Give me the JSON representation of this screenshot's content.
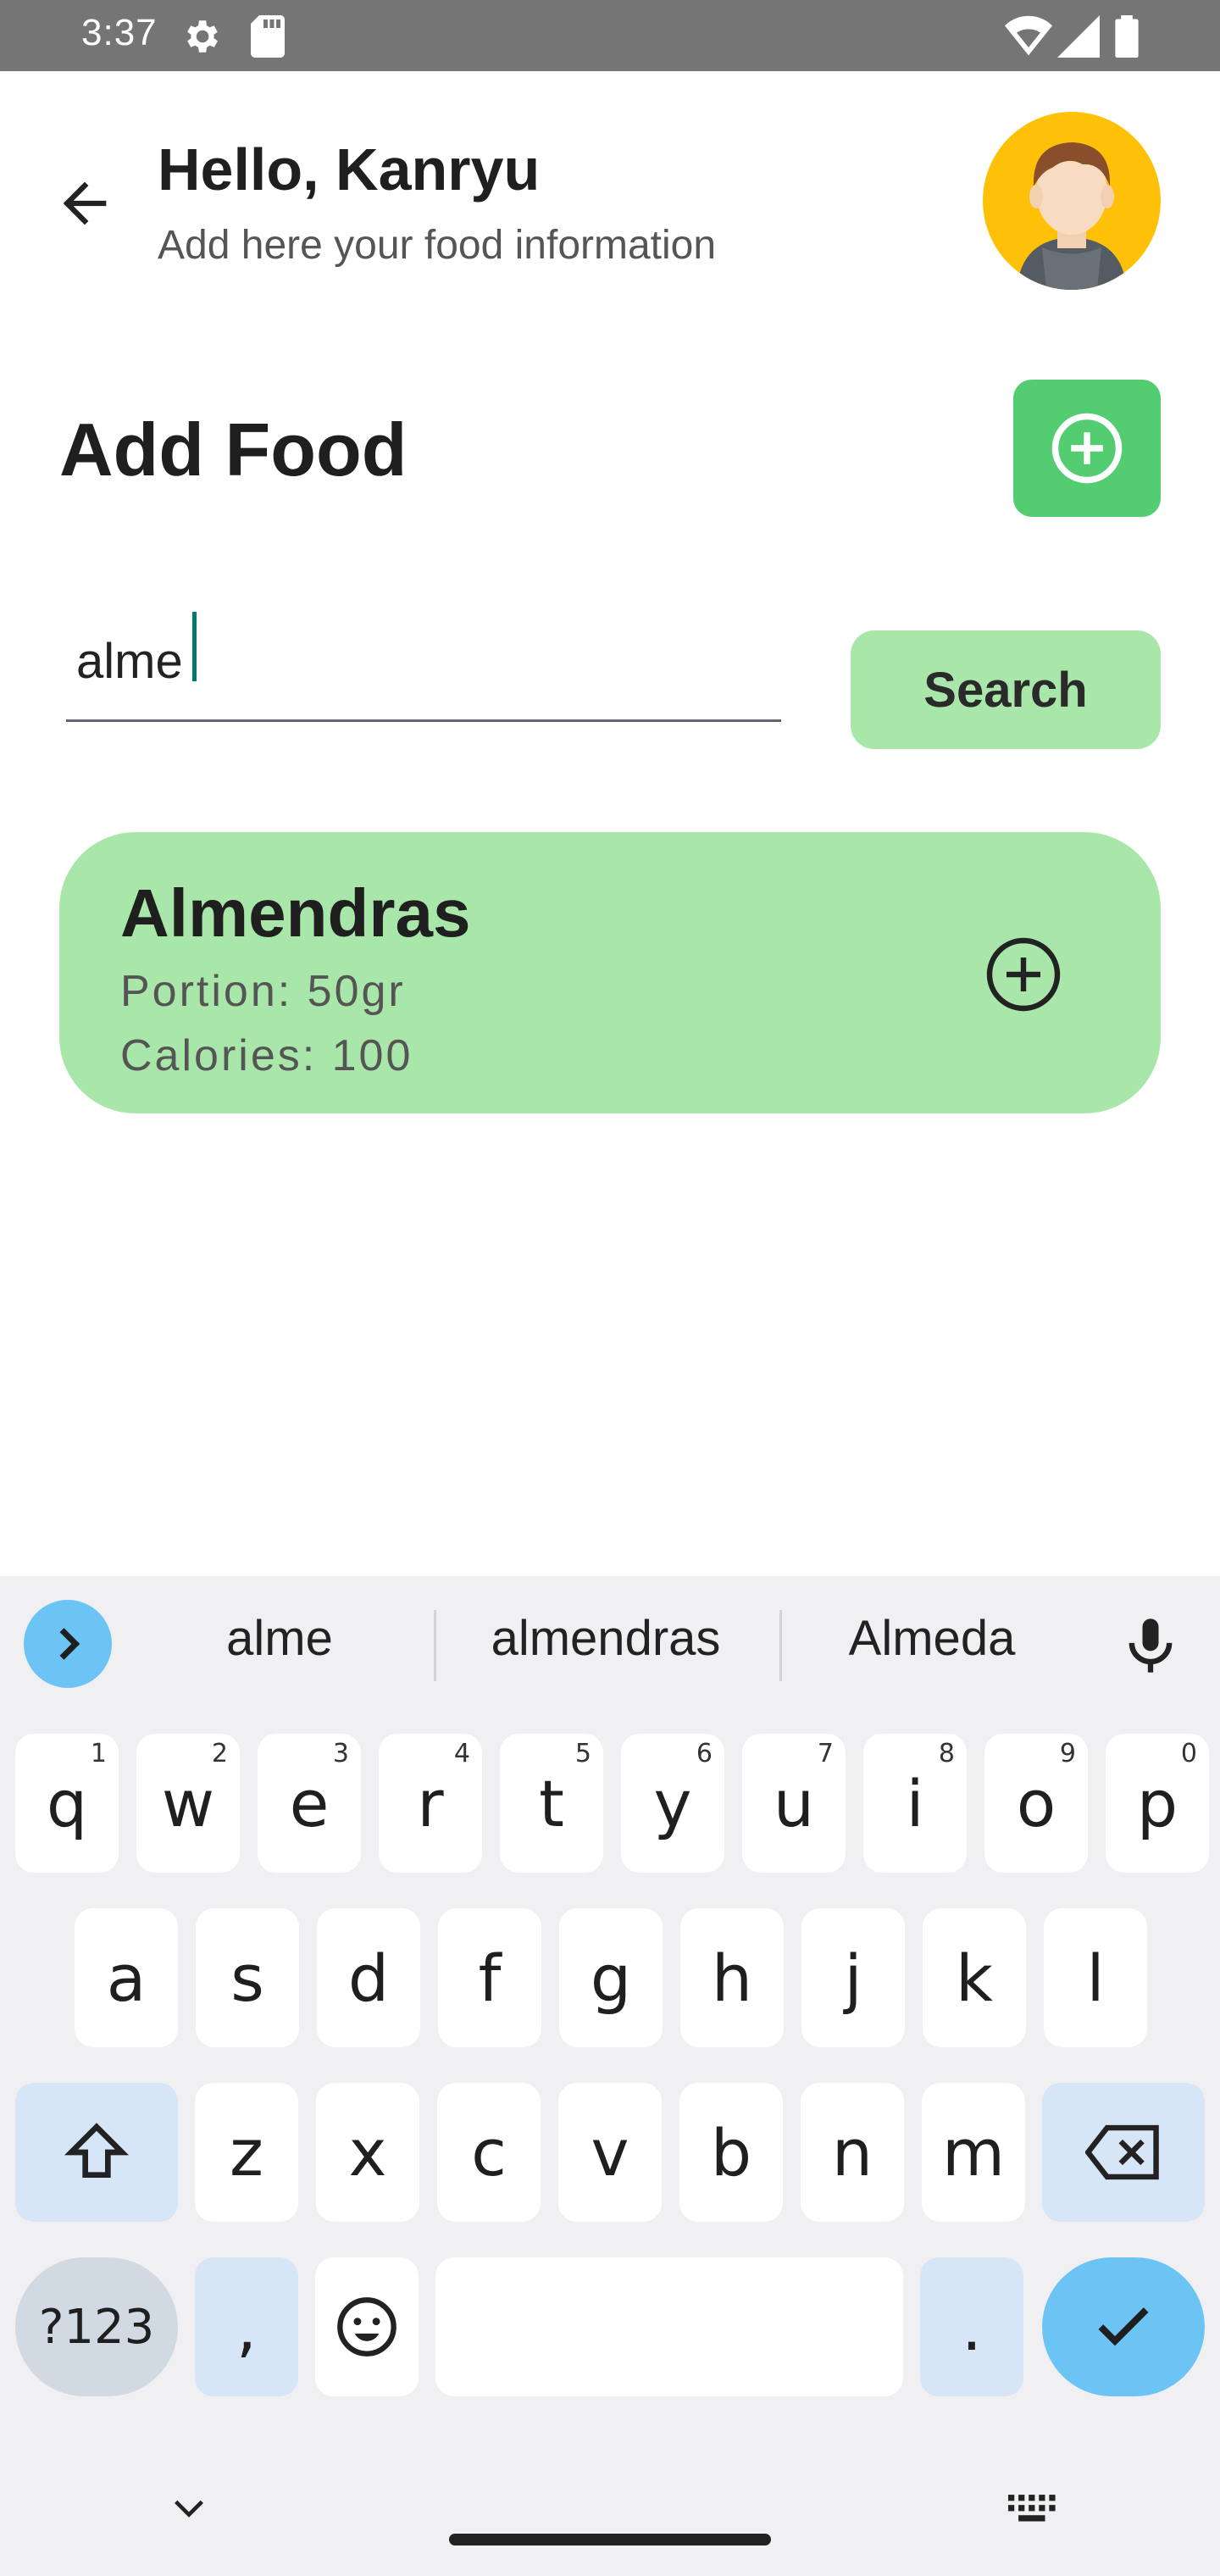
{
  "status_bar": {
    "time": "3:37"
  },
  "header": {
    "greeting": "Hello, Kanryu",
    "subtitle": "Add here your food information"
  },
  "section": {
    "title": "Add Food"
  },
  "search": {
    "value": "alme",
    "button_label": "Search"
  },
  "results": [
    {
      "name": "Almendras",
      "portion": "Portion: 50gr",
      "calories": "Calories: 100"
    }
  ],
  "keyboard": {
    "suggestions": [
      "alme",
      "almendras",
      "Almeda"
    ],
    "row1": [
      {
        "k": "q",
        "h": "1"
      },
      {
        "k": "w",
        "h": "2"
      },
      {
        "k": "e",
        "h": "3"
      },
      {
        "k": "r",
        "h": "4"
      },
      {
        "k": "t",
        "h": "5"
      },
      {
        "k": "y",
        "h": "6"
      },
      {
        "k": "u",
        "h": "7"
      },
      {
        "k": "i",
        "h": "8"
      },
      {
        "k": "o",
        "h": "9"
      },
      {
        "k": "p",
        "h": "0"
      }
    ],
    "row2": [
      "a",
      "s",
      "d",
      "f",
      "g",
      "h",
      "j",
      "k",
      "l"
    ],
    "row3": [
      "z",
      "x",
      "c",
      "v",
      "b",
      "n",
      "m"
    ],
    "symbols_label": "?123",
    "comma": ",",
    "period": "."
  },
  "colors": {
    "accent_green": "#54CC72",
    "card_green": "#A9E6A9",
    "avatar_bg": "#FFC107",
    "keyboard_accent": "#6CC4F5"
  }
}
